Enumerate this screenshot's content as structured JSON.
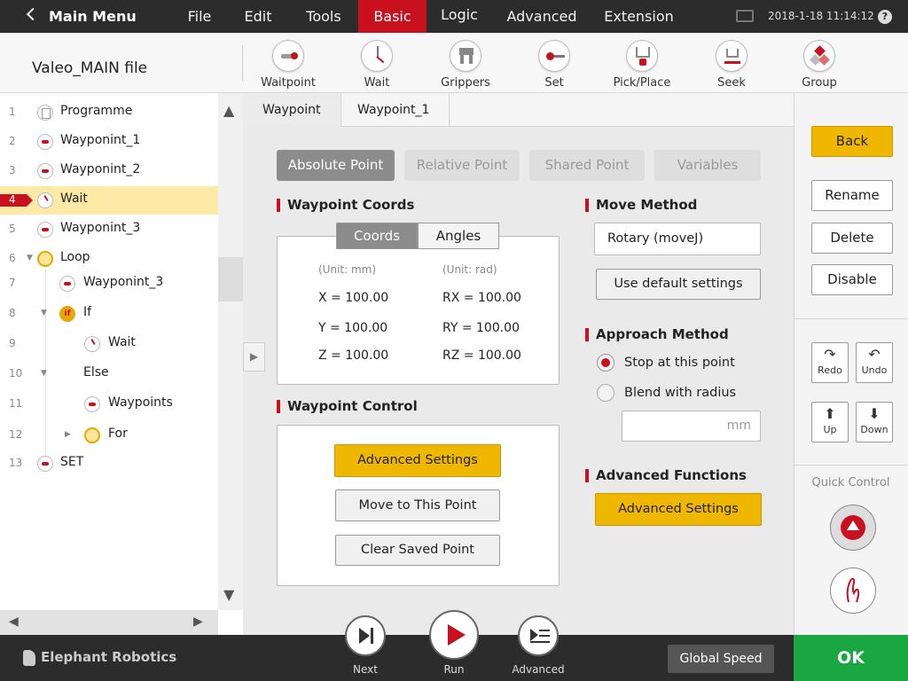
{
  "top_menu": {
    "main_menu_label": "Main Menu",
    "items": [
      "File",
      "Edit",
      "Tools",
      "Basic",
      "Logic",
      "Advanced",
      "Extension"
    ],
    "active": "Basic",
    "datetime": "2018-1-18 11:14:12",
    "help_label": "?"
  },
  "toolbar": {
    "file_title": "Valeo_MAIN file",
    "tools": [
      {
        "label": "Waitpoint",
        "icon": "waypoint-icon"
      },
      {
        "label": "Wait",
        "icon": "wait-icon"
      },
      {
        "label": "Grippers",
        "icon": "gripper-icon"
      },
      {
        "label": "Set",
        "icon": "set-icon"
      },
      {
        "label": "Pick/Place",
        "icon": "pick-place-icon"
      },
      {
        "label": "Seek",
        "icon": "seek-icon"
      },
      {
        "label": "Group",
        "icon": "group-icon"
      }
    ]
  },
  "tree": {
    "rows": [
      {
        "num": "1",
        "label": "Programme"
      },
      {
        "num": "2",
        "label": "Wayponint_1"
      },
      {
        "num": "3",
        "label": "Wayponint_2"
      },
      {
        "num": "4",
        "label": "Wait"
      },
      {
        "num": "5",
        "label": "Wayponint_3"
      },
      {
        "num": "6",
        "label": "Loop"
      },
      {
        "num": "7",
        "label": "Wayponint_3"
      },
      {
        "num": "8",
        "label": "If"
      },
      {
        "num": "9",
        "label": "Wait"
      },
      {
        "num": "10",
        "label": "Else"
      },
      {
        "num": "11",
        "label": "Waypoints"
      },
      {
        "num": "12",
        "label": "For"
      },
      {
        "num": "13",
        "label": "SET"
      }
    ],
    "selected": "4"
  },
  "panel": {
    "tabs": [
      "Waypoint",
      "Waypoint_1"
    ],
    "point_types": [
      "Absolute Point",
      "Relative Point",
      "Shared Point",
      "Variables"
    ],
    "active_point_type": "Absolute Point",
    "coords_header": "Waypoint Coords",
    "coord_tabs": [
      "Coords",
      "Angles"
    ],
    "active_coord_tab": "Coords",
    "unit_left": "(Unit: mm)",
    "unit_right": "(Unit: rad)",
    "coords": {
      "x": "X = 100.00",
      "y": "Y = 100.00",
      "z": "Z = 100.00",
      "rx": "RX = 100.00",
      "ry": "RY = 100.00",
      "rz": "RZ = 100.00"
    },
    "control_header": "Waypoint Control",
    "control_buttons": [
      "Advanced Settings",
      "Move to This Point",
      "Clear Saved Point"
    ],
    "move_method_header": "Move Method",
    "move_method_value": "Rotary (moveJ)",
    "use_default_label": "Use default settings",
    "approach_header": "Approach Method",
    "approach_options": [
      "Stop at this point",
      "Blend with radius"
    ],
    "approach_selected": "Stop at this point",
    "radius_unit": "mm",
    "adv_functions_header": "Advanced Functions",
    "adv_functions_button": "Advanced Settings"
  },
  "right_panel": {
    "back": "Back",
    "rename": "Rename",
    "delete": "Delete",
    "disable": "Disable",
    "redo": "Redo",
    "undo": "Undo",
    "up": "Up",
    "down": "Down",
    "quick_control": "Quick Control"
  },
  "bottom": {
    "brand": "Elephant Robotics",
    "next": "Next",
    "run": "Run",
    "advanced": "Advanced",
    "global_speed": "Global Speed",
    "ok": "OK"
  },
  "colors": {
    "accent_red": "#c8101f",
    "gold": "#f0b700",
    "ok_green": "#1aa640",
    "topbar": "#2c2c2c"
  }
}
